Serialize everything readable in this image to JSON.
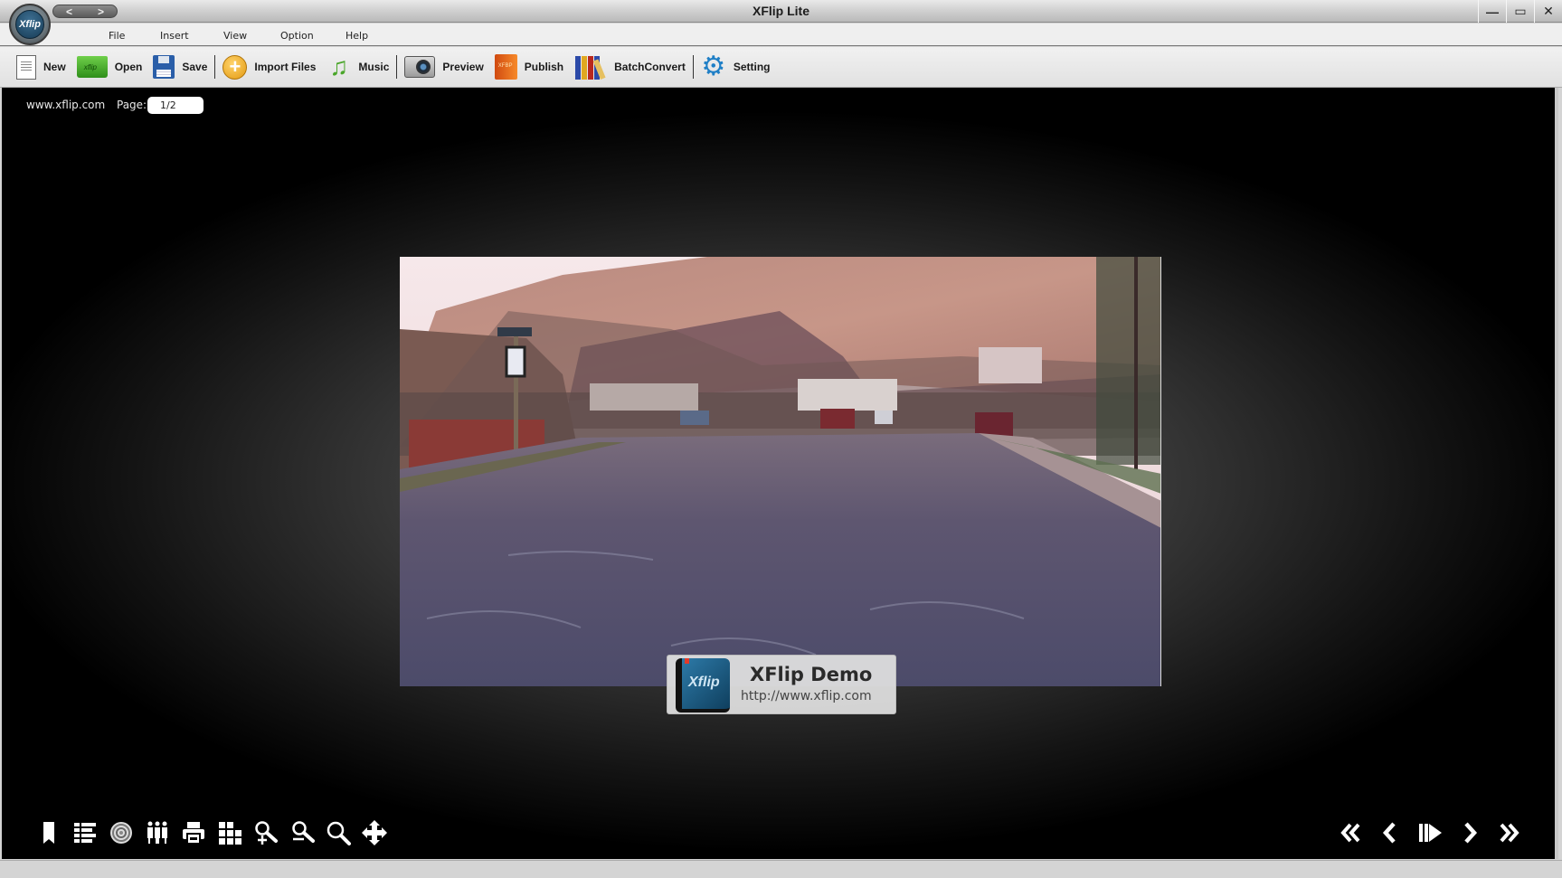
{
  "window": {
    "title": "XFlip Lite",
    "logo_text": "Xflip",
    "nav_back": "<",
    "nav_forward": ">",
    "minimize": "—",
    "maximize": "▭",
    "close": "✕"
  },
  "menu": {
    "items": [
      {
        "label": "File"
      },
      {
        "label": "Insert"
      },
      {
        "label": "View"
      },
      {
        "label": "Option"
      },
      {
        "label": "Help"
      }
    ]
  },
  "toolbar": {
    "buttons": [
      {
        "id": "new",
        "label": "New",
        "icon": "new-document-icon"
      },
      {
        "id": "open",
        "label": "Open",
        "icon": "open-folder-icon"
      },
      {
        "id": "save",
        "label": "Save",
        "icon": "floppy-disk-icon"
      },
      {
        "id": "import",
        "label": "Import Files",
        "icon": "plus-circle-icon"
      },
      {
        "id": "music",
        "label": "Music",
        "icon": "music-note-icon"
      },
      {
        "id": "preview",
        "label": "Preview",
        "icon": "camera-icon"
      },
      {
        "id": "publish",
        "label": "Publish",
        "icon": "book-icon"
      },
      {
        "id": "batch",
        "label": "BatchConvert",
        "icon": "books-icon"
      },
      {
        "id": "setting",
        "label": "Setting",
        "icon": "gear-icon"
      }
    ],
    "glyphs": {
      "import": "+",
      "music": "♫",
      "gear": "⚙"
    }
  },
  "viewer": {
    "site_link": "www.xflip.com",
    "page_label": "Page:",
    "page_value": "1/2",
    "photo_alt": "Suburban street with mountain in background",
    "badge": {
      "title": "XFlip Demo",
      "url": "http://www.xflip.com",
      "book_text": "Xflip"
    }
  },
  "controls": {
    "left": [
      {
        "name": "bookmark-icon",
        "tooltip": "Bookmark"
      },
      {
        "name": "table-of-contents-icon",
        "tooltip": "Table of Contents"
      },
      {
        "name": "sound-icon",
        "tooltip": "Sound"
      },
      {
        "name": "share-icon",
        "tooltip": "Share"
      },
      {
        "name": "print-icon",
        "tooltip": "Print"
      },
      {
        "name": "thumbnails-icon",
        "tooltip": "Thumbnails"
      },
      {
        "name": "zoom-in-icon",
        "tooltip": "Zoom In"
      },
      {
        "name": "zoom-out-icon",
        "tooltip": "Zoom Out"
      },
      {
        "name": "search-icon",
        "tooltip": "Search"
      },
      {
        "name": "move-icon",
        "tooltip": "Move"
      }
    ],
    "right": [
      {
        "name": "first-page-icon",
        "tooltip": "First Page"
      },
      {
        "name": "previous-page-icon",
        "tooltip": "Previous Page"
      },
      {
        "name": "autoplay-icon",
        "tooltip": "Auto Flip"
      },
      {
        "name": "next-page-icon",
        "tooltip": "Next Page"
      },
      {
        "name": "last-page-icon",
        "tooltip": "Last Page"
      }
    ]
  },
  "colors": {
    "viewer_bg": "#000000",
    "accent_gear": "#1f7fc6",
    "music_green": "#4aa62a",
    "import_orange": "#e39a12"
  }
}
